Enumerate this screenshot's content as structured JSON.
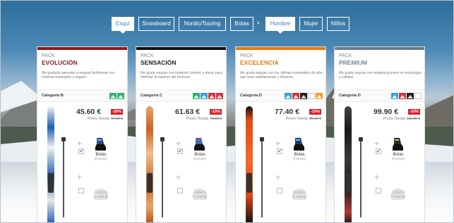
{
  "nav": {
    "tabs": [
      {
        "label": "Esquí",
        "active": true
      },
      {
        "label": "Snowboard"
      },
      {
        "label": "Nordic/Touring"
      },
      {
        "label": "Botas"
      },
      {
        "label": "Hombre",
        "active": true
      },
      {
        "label": "Mujer"
      },
      {
        "label": "Niños"
      }
    ],
    "separator": "›"
  },
  "cards": [
    {
      "pack_label": "PACK",
      "name": "EVOLUCIÓN",
      "accent": "#8b1a1a",
      "description": "Me gustaría aprender a esquiar fácilmente con material manejable y seguro.",
      "category": "Categoría B",
      "level_icons": [
        "green-level-icon",
        "green-level-icon"
      ],
      "price": "45.60 €",
      "discount": "-20%",
      "store_price_label": "Precio Tienda:",
      "store_price": "57.00 €",
      "boots_label": "Botas",
      "boots_sub": "(incluido)",
      "helmet_label": "Casco",
      "helmet_sub": "(+ 8.00 €)"
    },
    {
      "pack_label": "PACK",
      "name": "SENSACIÓN",
      "accent": "#111111",
      "description": "Me gusta esquiar con material cómodo y eficaz para disfrutar al máximo del territorio.",
      "category": "Categoría C",
      "level_icons": [
        "green-level-icon",
        "blue-level-icon",
        "red-level-icon",
        "red-level-icon"
      ],
      "price": "61.63 €",
      "discount": "-15%",
      "store_price_label": "Precio Tienda:",
      "store_price": "72.50 €",
      "boots_label": "Botas",
      "boots_sub": "(incluido)",
      "helmet_label": "Casco",
      "helmet_sub": "(+ 8.00 €)"
    },
    {
      "pack_label": "PACK",
      "name": "EXCELENCIA",
      "accent": "#e07b14",
      "description": "Me gusta esquiar con las últimas novedades del año, que sean satisfactorias y eficaces.",
      "category": "Categoría D",
      "level_icons": [
        "blue-level-icon",
        "red-level-icon",
        "black-level-icon",
        "freeride-level-icon",
        "park-level-icon"
      ],
      "price": "77.40 €",
      "discount": "-10%",
      "store_price_label": "Precio Tienda:",
      "store_price": "86.00 €",
      "boots_label": "Botas",
      "boots_sub": "(incluido)",
      "helmet_label": "Casco",
      "helmet_sub": "(+ 8.00 €)"
    },
    {
      "pack_label": "PACK",
      "name": "PREMIUM",
      "accent": "#6b7a8a",
      "description": "Me gusta esquiar con material puntero en tecnología y calidad.",
      "category": "Categoría D",
      "level_icons": [
        "blue-level-icon",
        "red-level-icon",
        "black-level-icon",
        "freeride-level-icon"
      ],
      "price": "99.90 €",
      "discount": "-10%",
      "store_price_label": "Precio Tienda:",
      "store_price": "111.00 €",
      "boots_label": "Botas",
      "boots_sub": "(incluido)",
      "helmet_label": "Casco",
      "helmet_sub": "(+ 8.00 €)"
    }
  ],
  "colors": {
    "discount_bg": "#d6202d",
    "tab_active_text": "#3a88c8",
    "level_green": "#2fb36a",
    "level_blue": "#3aa0d8",
    "level_red": "#d9333f",
    "level_black": "#222222",
    "level_orange": "#f0a030"
  }
}
